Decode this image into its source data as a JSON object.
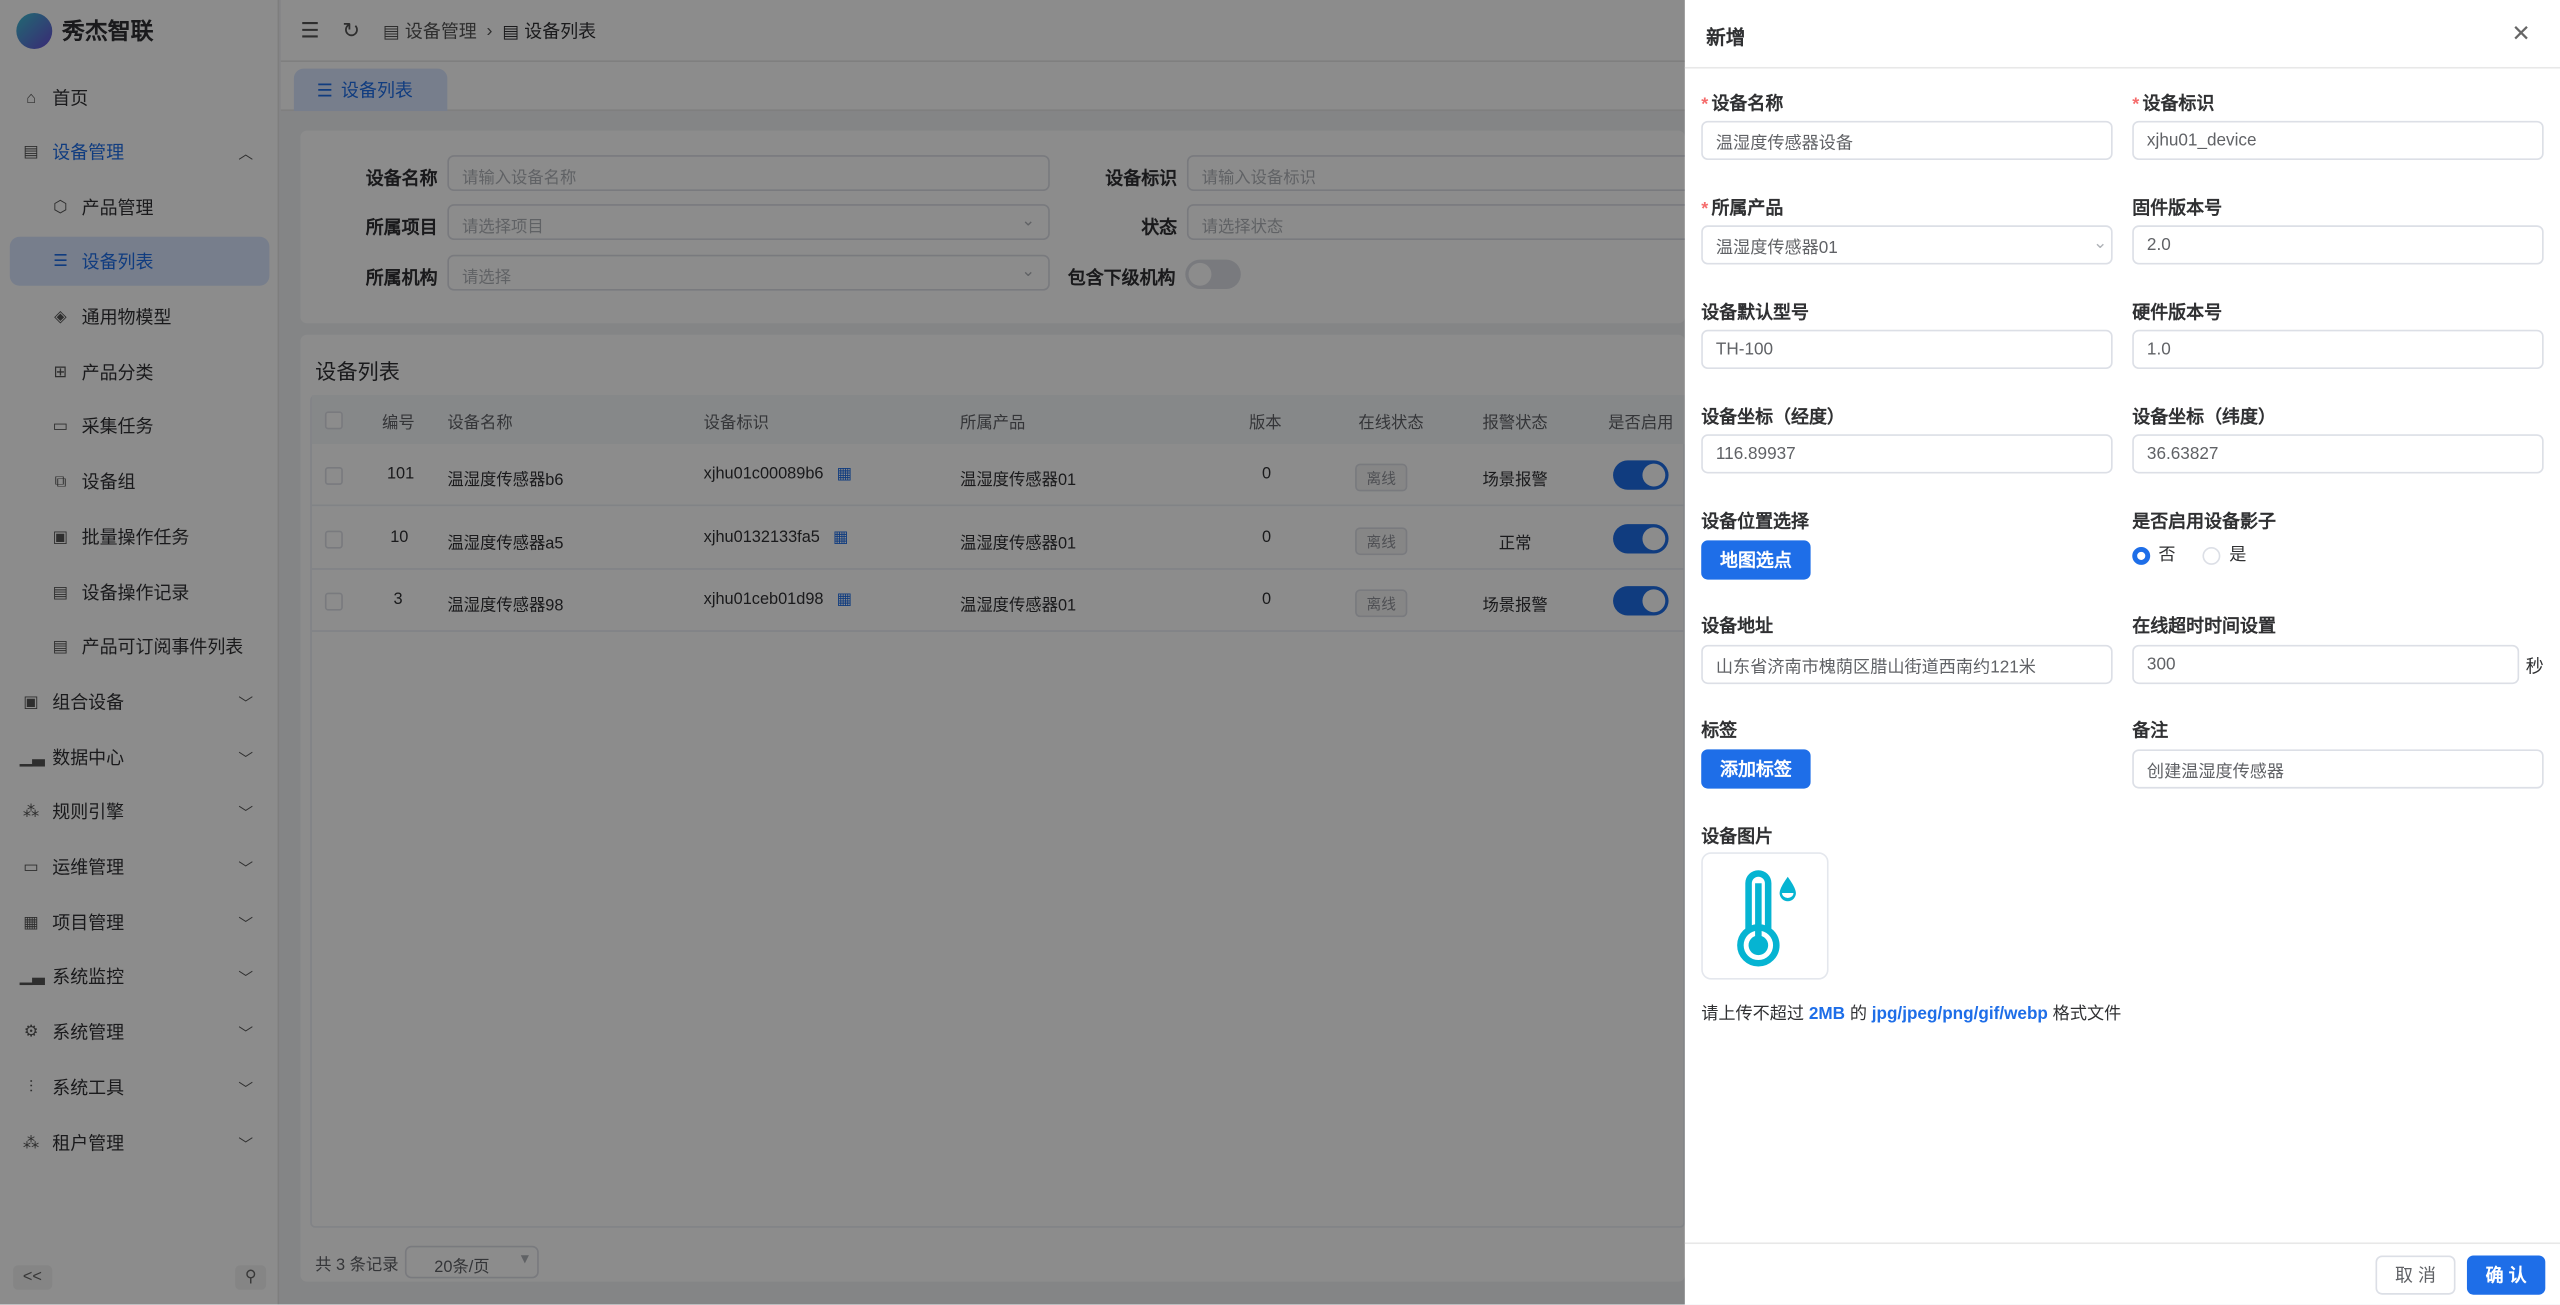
{
  "app": {
    "name": "秀杰智联"
  },
  "sidebar": {
    "items": [
      {
        "label": "首页",
        "icon": "home-icon"
      },
      {
        "label": "设备管理",
        "icon": "server-icon"
      },
      {
        "label": "产品管理",
        "icon": "cube-icon"
      },
      {
        "label": "设备列表",
        "icon": "list-icon"
      },
      {
        "label": "通用物模型",
        "icon": "model-icon"
      },
      {
        "label": "产品分类",
        "icon": "category-icon"
      },
      {
        "label": "采集任务",
        "icon": "calendar-icon"
      },
      {
        "label": "设备组",
        "icon": "group-icon"
      },
      {
        "label": "批量操作任务",
        "icon": "batch-icon"
      },
      {
        "label": "设备操作记录",
        "icon": "record-icon"
      },
      {
        "label": "产品可订阅事件列表",
        "icon": "event-icon"
      },
      {
        "label": "组合设备",
        "icon": "combo-icon"
      },
      {
        "label": "数据中心",
        "icon": "bar-chart-icon"
      },
      {
        "label": "规则引擎",
        "icon": "rule-icon"
      },
      {
        "label": "运维管理",
        "icon": "monitor-icon"
      },
      {
        "label": "项目管理",
        "icon": "grid-icon"
      },
      {
        "label": "系统监控",
        "icon": "bar-chart-icon"
      },
      {
        "label": "系统管理",
        "icon": "gear-icon"
      },
      {
        "label": "系统工具",
        "icon": "tools-icon"
      },
      {
        "label": "租户管理",
        "icon": "tenant-icon"
      }
    ],
    "collapse": "<<",
    "pin": "⚲"
  },
  "header": {
    "breadcrumb": [
      "设备管理",
      "设备列表"
    ]
  },
  "tabs": [
    {
      "label": "设备列表"
    }
  ],
  "search": {
    "device_name": {
      "label": "设备名称",
      "placeholder": "请输入设备名称"
    },
    "device_id": {
      "label": "设备标识",
      "placeholder": "请输入设备标识"
    },
    "project": {
      "label": "所属项目",
      "placeholder": "请选择项目"
    },
    "status": {
      "label": "状态",
      "placeholder": "请选择状态"
    },
    "org": {
      "label": "所属机构",
      "placeholder": "请选择"
    },
    "include_sub": {
      "label": "包含下级机构",
      "value": false
    }
  },
  "table": {
    "title": "设备列表",
    "columns": [
      "编号",
      "设备名称",
      "设备标识",
      "所属产品",
      "版本",
      "在线状态",
      "报警状态",
      "是否启用"
    ],
    "rows": [
      {
        "id": "101",
        "name": "温湿度传感器b6",
        "key": "xjhu01c00089b6",
        "product": "温湿度传感器01",
        "version": "0",
        "online": "离线",
        "alarm": "场景报警",
        "enabled": true
      },
      {
        "id": "10",
        "name": "温湿度传感器a5",
        "key": "xjhu0132133fa5",
        "product": "温湿度传感器01",
        "version": "0",
        "online": "离线",
        "alarm": "正常",
        "enabled": true
      },
      {
        "id": "3",
        "name": "温湿度传感器98",
        "key": "xjhu01ceb01d98",
        "product": "温湿度传感器01",
        "version": "0",
        "online": "离线",
        "alarm": "场景报警",
        "enabled": true
      }
    ],
    "total": "共 3 条记录",
    "page_size": "20条/页"
  },
  "drawer": {
    "title": "新增",
    "fields": {
      "name": {
        "label": "设备名称",
        "value": "温湿度传感器设备",
        "required": true
      },
      "key": {
        "label": "设备标识",
        "value": "xjhu01_device",
        "required": true
      },
      "product": {
        "label": "所属产品",
        "value": "温湿度传感器01",
        "required": true
      },
      "firmware": {
        "label": "固件版本号",
        "value": "2.0"
      },
      "model": {
        "label": "设备默认型号",
        "value": "TH-100"
      },
      "hardware": {
        "label": "硬件版本号",
        "value": "1.0"
      },
      "lng": {
        "label": "设备坐标（经度）",
        "value": "116.89937"
      },
      "lat": {
        "label": "设备坐标（纬度）",
        "value": "36.63827"
      },
      "location": {
        "label": "设备位置选择",
        "button": "地图选点"
      },
      "shadow": {
        "label": "是否启用设备影子",
        "options": [
          "否",
          "是"
        ],
        "selected": "否"
      },
      "address": {
        "label": "设备地址",
        "value": "山东省济南市槐荫区腊山街道西南约121米"
      },
      "timeout": {
        "label": "在线超时时间设置",
        "value": "300",
        "unit": "秒"
      },
      "tags": {
        "label": "标签",
        "button": "添加标签"
      },
      "remark": {
        "label": "备注",
        "value": "创建温湿度传感器"
      },
      "image": {
        "label": "设备图片"
      }
    },
    "upload_tip": {
      "prefix": "请上传不超过",
      "size": "2MB",
      "mid": "的",
      "formats": "jpg/jpeg/png/gif/webp",
      "suffix": "格式文件"
    },
    "cancel": "取 消",
    "confirm": "确 认"
  },
  "colors": {
    "primary": "#1e6ee8",
    "required": "#f56c6c",
    "thermometer": "#06b4d2"
  }
}
